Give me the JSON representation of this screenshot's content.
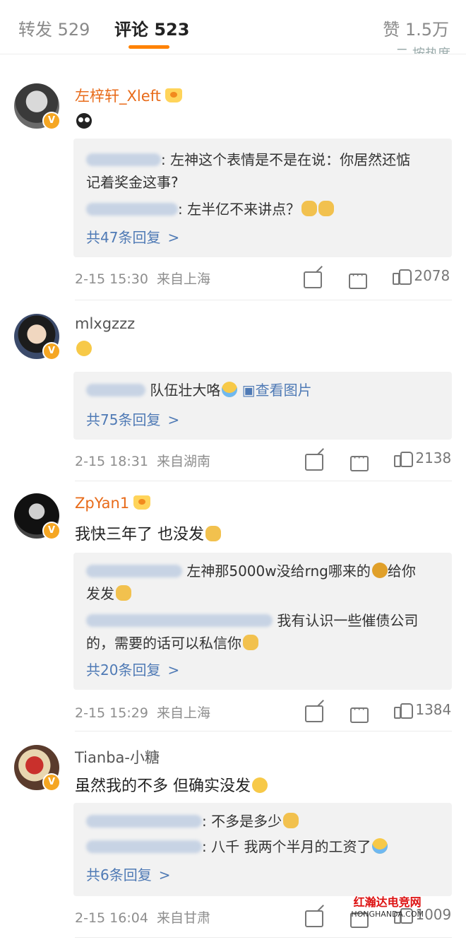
{
  "tabs": {
    "repost": "转发 529",
    "comments": "评论 523",
    "likes": "赞 1.5万",
    "sort_peek": "二 按热度"
  },
  "comments": [
    {
      "user": "左梓轩_Xleft",
      "text": "",
      "reply_lines": [
        ": 左神这个表情是不是在说：你居然还惦",
        "记着奖金这事?",
        ": 左半亿不来讲点？"
      ],
      "more": "共47条回复",
      "time": "2-15 15:30",
      "location": "来自上海",
      "likes": "2078"
    },
    {
      "user": "mlxgzzz",
      "text": "",
      "reply_lines": [
        "队伍壮大咯",
        "查看图片"
      ],
      "more": "共75条回复",
      "time": "2-15 18:31",
      "location": "来自湖南",
      "likes": "2138"
    },
    {
      "user": "ZpYan1",
      "text": "我快三年了 也没发",
      "reply_lines": [
        "左神那5000w没给rng哪来的",
        "给你",
        "发发",
        "我有认识一些催债公司",
        "的，需要的话可以私信你"
      ],
      "more": "共20条回复",
      "time": "2-15 15:29",
      "location": "来自上海",
      "likes": "1384"
    },
    {
      "user": "Tianba-小糖",
      "text": "虽然我的不多 但确实没发",
      "reply_lines": [
        ": 不多是多少",
        ": 八千 我两个半月的工资了"
      ],
      "more": "共6条回复",
      "time": "2-15 16:04",
      "location": "来自甘肃",
      "likes": "1009"
    }
  ],
  "more_chevron": ">",
  "vbadge": "V",
  "watermark": {
    "line1": "红瀚达电竞网",
    "line2": "HONGHANDA.COM"
  },
  "colors": {
    "accent": "#ff8200",
    "link": "#4f7ab5",
    "username": "#e86b1a"
  }
}
